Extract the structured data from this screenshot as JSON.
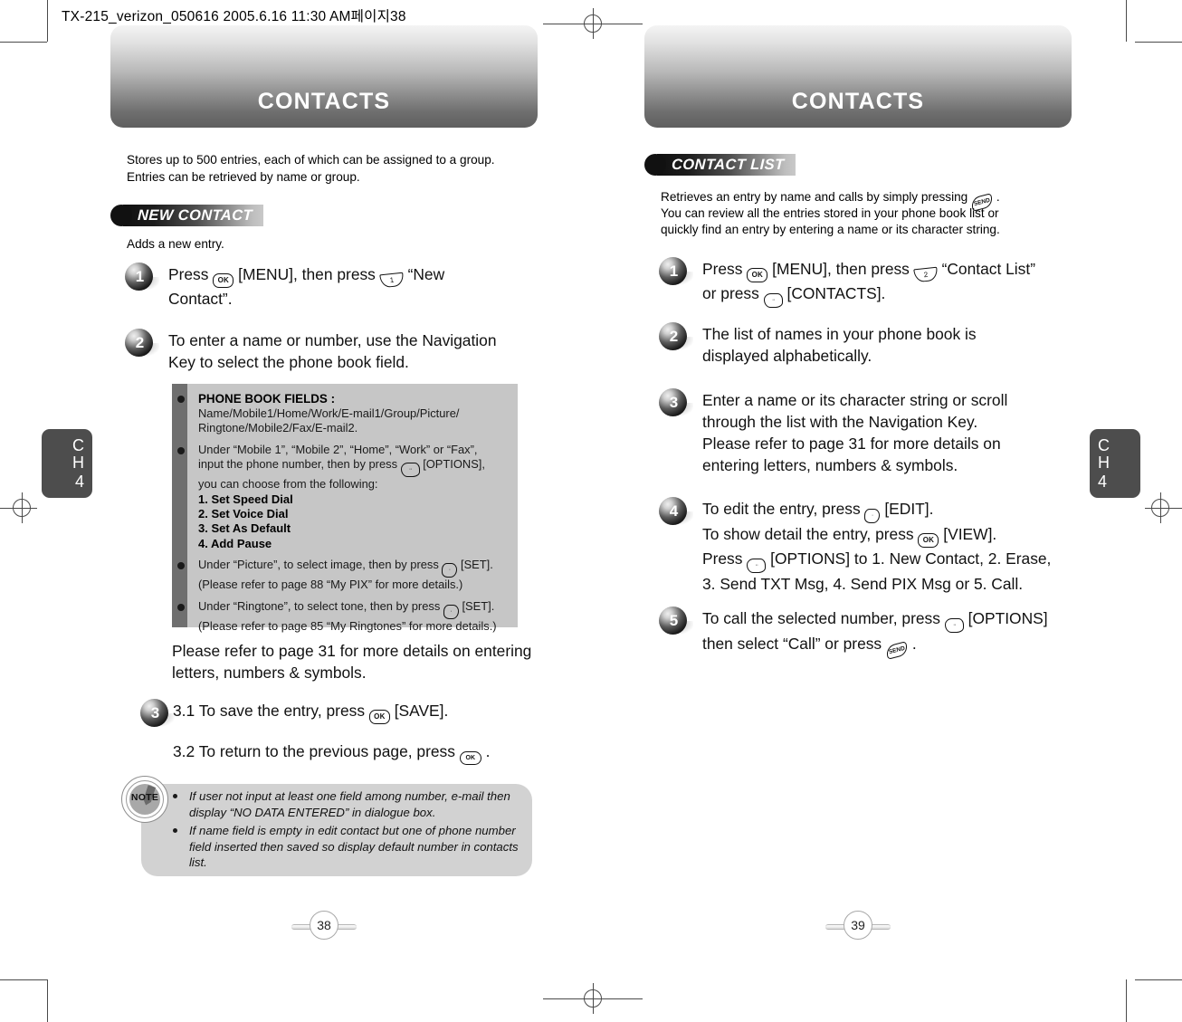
{
  "document": {
    "header_line": "TX-215_verizon_050616  2005.6.16 11:30 AM페이지38"
  },
  "chapter_tab": {
    "label": "CH",
    "number": "4"
  },
  "left_page": {
    "banner_title": "CONTACTS",
    "page_number": "38",
    "intro": "Stores up to 500 entries, each of which can be assigned to a group.\nEntries can be retrieved by name or group.",
    "section": {
      "title": "NEW CONTACT",
      "subtitle": "Adds a new entry."
    },
    "steps": [
      {
        "num": "1",
        "text": "Press  [MENU], then press  “New Contact”."
      },
      {
        "num": "2",
        "text": "To enter a name or number, use the Navigation Key to select the phone book field."
      },
      {
        "num": "3",
        "text": "3.1 To save the entry, press  [SAVE]."
      }
    ],
    "step1_parts": {
      "a": "Press",
      "key1": "OK",
      "b": "[MENU], then press",
      "key2": "1",
      "c": "“New",
      "d": "Contact”."
    },
    "step2_text_l1": "To enter a name or number, use the Navigation",
    "step2_text_l2": "Key to select the phone book field.",
    "infobox": {
      "items": [
        {
          "title": "PHONE BOOK FIELDS :",
          "lines": [
            "Name/Mobile1/Home/Work/E-mail1/Group/Picture/",
            "Ringtone/Mobile2/Fax/E-mail2."
          ]
        },
        {
          "lines": [
            "Under “Mobile 1”, “Mobile 2”, “Home”, “Work” or “Fax”,",
            "input the phone number, then by press",
            "[OPTIONS],",
            "you can choose from the following:"
          ],
          "options": [
            "1. Set Speed Dial",
            "2. Set Voice Dial",
            "3. Set As Default",
            "4. Add Pause"
          ]
        },
        {
          "lines": [
            "Under “Picture”, to select image, then by press",
            "[SET].",
            "(Please refer to page 88 “My PIX” for more details.)"
          ]
        },
        {
          "lines": [
            "Under “Ringtone”, to select tone, then by press",
            "[SET].",
            "(Please refer to page 85 “My Ringtones” for more details.)"
          ]
        }
      ]
    },
    "refer_note_l1": "Please refer to page 31 for more details on entering",
    "refer_note_l2": "letters, numbers & symbols.",
    "step3_1_a": "3.1 To save the entry, press",
    "step3_1_b": "[SAVE].",
    "step3_2_a": "3.2 To return to the previous page, press",
    "step3_2_b": ".",
    "note": {
      "icon_label": "NOTE",
      "items": [
        "If user not input at least one field among number, e-mail then display “NO DATA ENTERED” in dialogue box.",
        "If name field is empty in edit contact but one of phone number field inserted then saved so display default number in contacts list."
      ]
    }
  },
  "right_page": {
    "banner_title": "CONTACTS",
    "page_number": "39",
    "section": {
      "title": "CONTACT LIST"
    },
    "intro_l1_a": "Retrieves an entry by name and calls by simply pressing",
    "intro_l1_b": ".",
    "intro_l2": "You can review all the entries stored in your phone book list or",
    "intro_l3": "quickly find an entry by entering a name or its character string.",
    "steps": [
      {
        "num": "1",
        "l1_a": "Press",
        "l1_key": "OK",
        "l1_b": "[MENU], then press",
        "l1_key2": "2",
        "l1_c": "“Contact List”",
        "l2_a": "or press",
        "l2_b": "[CONTACTS]."
      },
      {
        "num": "2",
        "l1": "The list of names in your phone book is",
        "l2": "displayed alphabetically."
      },
      {
        "num": "3",
        "l1": "Enter a name or its character string or scroll",
        "l2": "through the list with the Navigation Key.",
        "l3": "Please refer to page 31 for more details on",
        "l4": "entering letters, numbers & symbols."
      },
      {
        "num": "4",
        "l1_a": "To edit the entry, press",
        "l1_b": "[EDIT].",
        "l2_a": "To show detail the entry, press",
        "l2_b": "[VIEW].",
        "l3_a": "Press",
        "l3_b": "[OPTIONS] to 1. New Contact, 2. Erase,",
        "l4": "3. Send TXT Msg, 4. Send PIX Msg or 5. Call."
      },
      {
        "num": "5",
        "l1_a": "To call the selected number, press",
        "l1_b": "[OPTIONS]",
        "l2_a": "then select “Call” or press",
        "l2_b": "."
      }
    ]
  },
  "keys": {
    "ok": "OK",
    "num1": "1",
    "num2": "2",
    "send": "SEND",
    "options": "··",
    "soft_left": "·"
  },
  "colors": {
    "banner_dark": "#5f5f5f",
    "banner_light": "#f4f4f4",
    "infobox_bg": "#c6c6c6",
    "infobox_strip": "#6f6f6f",
    "note_bg": "#d2d2d2",
    "tab_bg": "#4d4d4d"
  }
}
